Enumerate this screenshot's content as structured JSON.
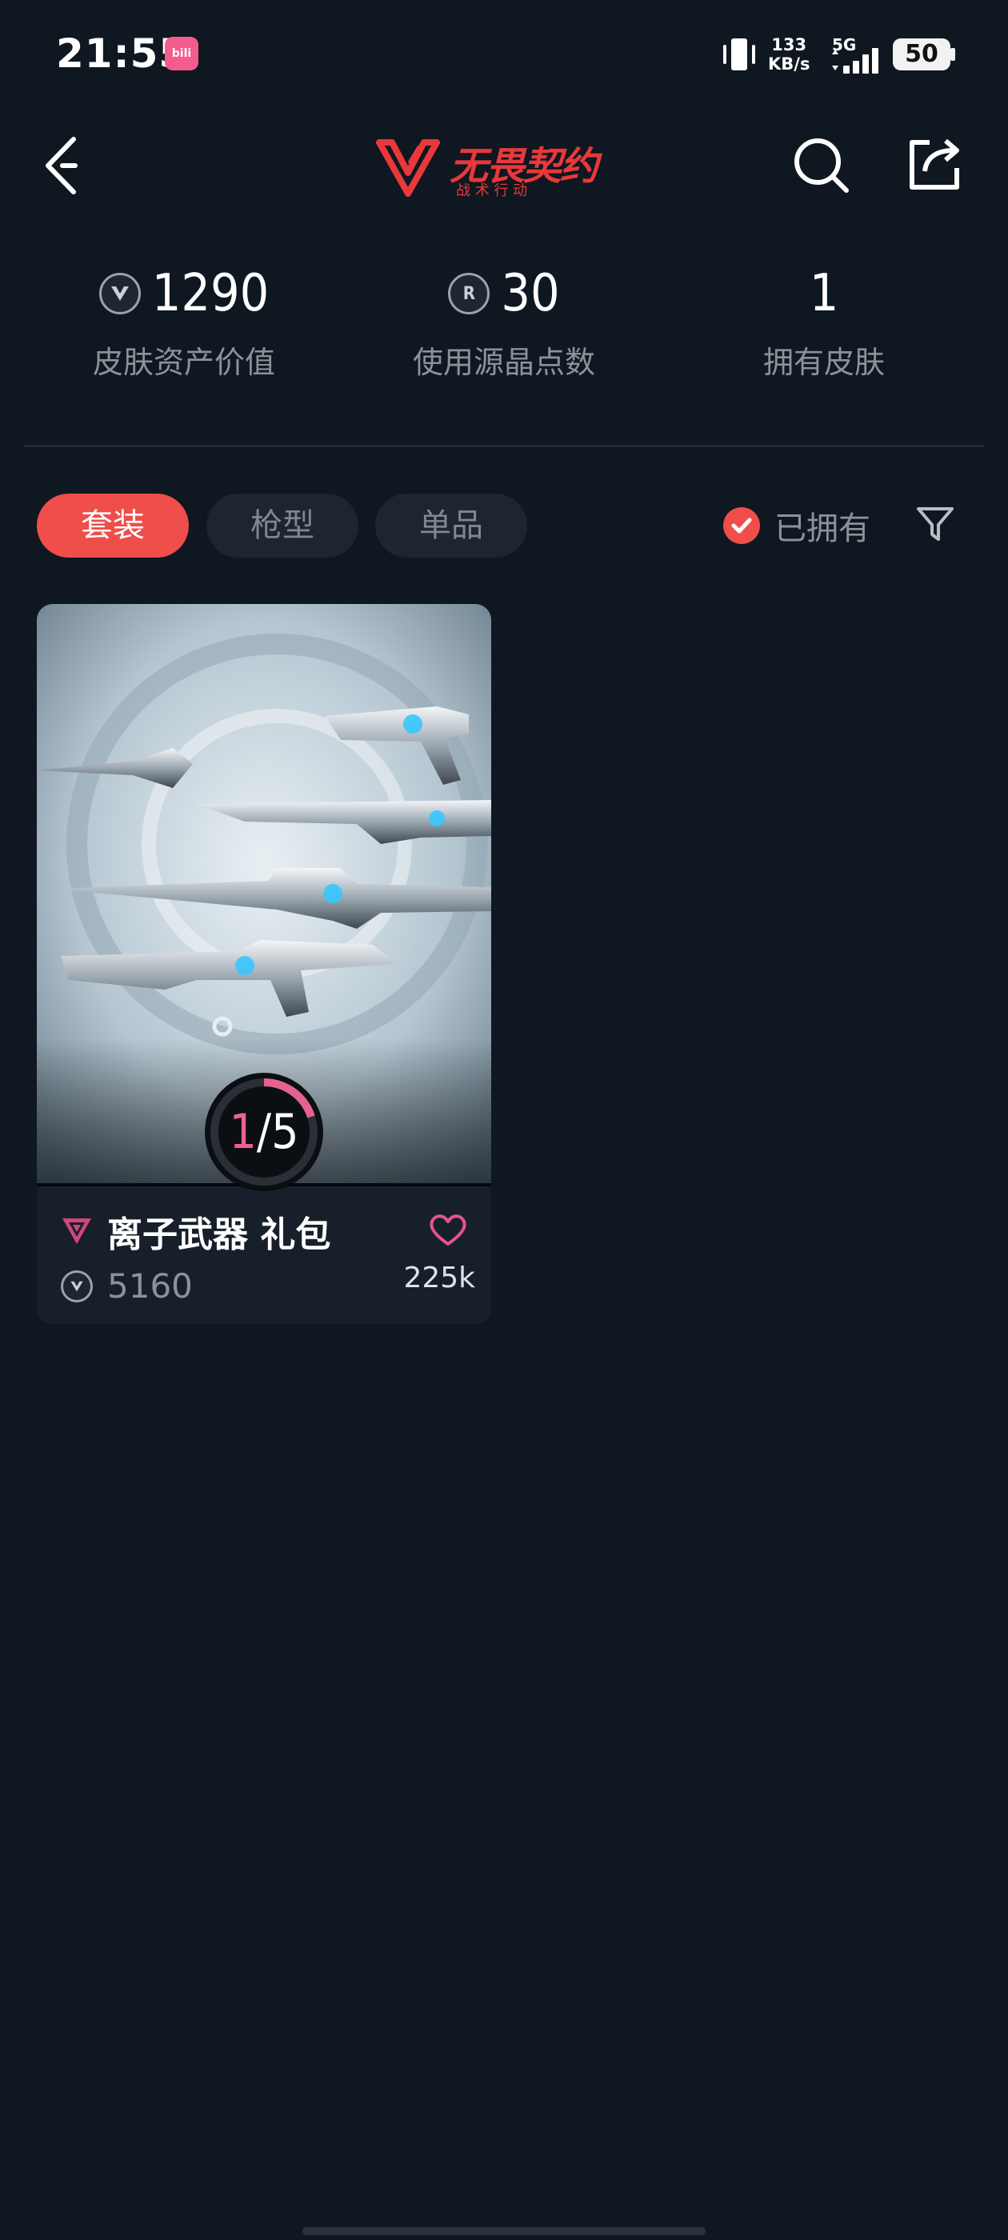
{
  "status_bar": {
    "time": "21:55",
    "app_badge": "bilibili",
    "net_speed_value": "133",
    "net_speed_unit": "KB/s",
    "network": "5G",
    "battery": "50"
  },
  "header": {
    "logo_title": "无畏契约",
    "logo_subtitle": "战 术 行 动",
    "back_icon": "chevron-left-icon",
    "search_icon": "search-icon",
    "share_icon": "share-icon",
    "brand_color": "#e8383b"
  },
  "stats": [
    {
      "value": "1290",
      "label": "皮肤资产价值",
      "icon": "vp-coin-icon"
    },
    {
      "value": "30",
      "label": "使用源晶点数",
      "icon": "radianite-coin-icon"
    },
    {
      "value": "1",
      "label": "拥有皮肤"
    }
  ],
  "tabs": [
    {
      "label": "套装",
      "active": true
    },
    {
      "label": "枪型",
      "active": false
    },
    {
      "label": "单品",
      "active": false
    }
  ],
  "filter": {
    "owned_label": "已拥有",
    "owned_checked": true,
    "filter_icon": "filter-icon",
    "accent": "#ef4e4a"
  },
  "bundles": [
    {
      "name": "离子武器 礼包",
      "price": "5160",
      "likes": "225k",
      "progress_owned": "1",
      "progress_total": "5",
      "progress_fraction": 0.2,
      "tier_icon": "premium-tier-icon",
      "tier_color": "#d1467a"
    }
  ]
}
